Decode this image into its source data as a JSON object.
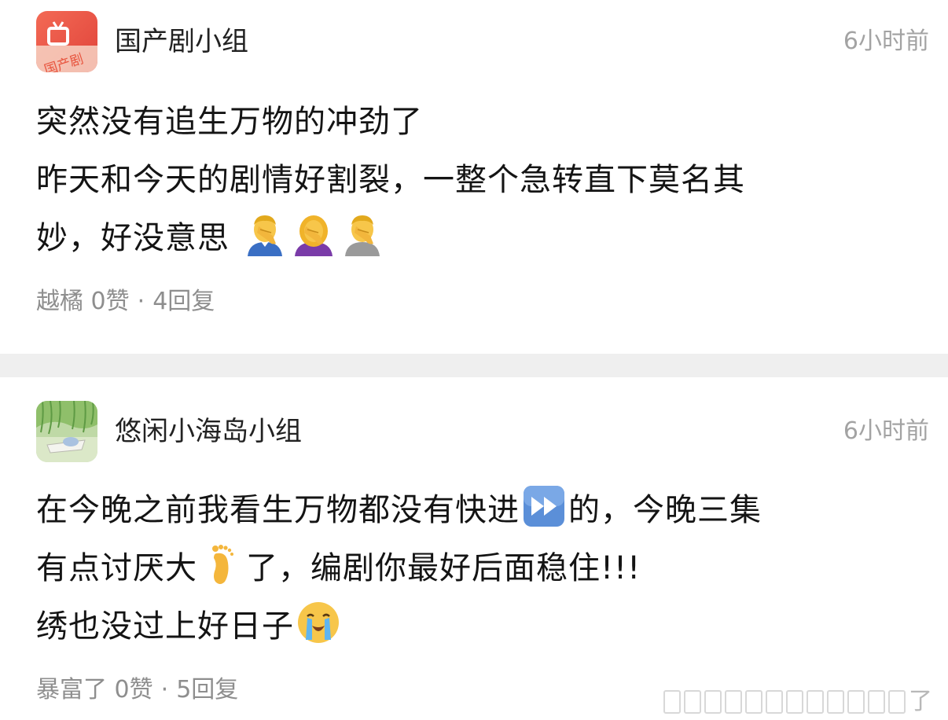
{
  "posts": [
    {
      "group_name": "国产剧小组",
      "avatar_text": "国产剧",
      "time": "6小时前",
      "lines": [
        [
          "突然没有追生万物的冲劲了"
        ],
        [
          "昨天和今天的剧情好割裂，一整个急转直下莫名其"
        ],
        [
          "妙，好没意思"
        ]
      ],
      "author": "越橘",
      "likes": "0赞",
      "separator": "·",
      "replies": "4回复",
      "icons": [
        "man-facepalming-emoji",
        "woman-facepalming-emoji",
        "person-facepalming-emoji"
      ]
    },
    {
      "group_name": "悠闲小海岛小组",
      "time": "6小时前",
      "line1_a": "在今晚之前我看生万物都没有快进",
      "line1_b": "的，今晚三集",
      "line2_a": "有点讨厌大",
      "line2_b": "了，编剧你最好后面稳住!!!",
      "line3": "绣也没过上好日子",
      "author": "暴富了",
      "likes": "0赞",
      "separator": "·",
      "replies": "5回复",
      "icons": [
        "fast-forward-emoji",
        "foot-emoji",
        "loudly-crying-face-emoji"
      ]
    }
  ],
  "watermark_tail": "了",
  "colors": {
    "avatar_red": "#e2453c",
    "meta_gray": "#8e8e8e",
    "time_gray": "#a3a3a3",
    "divider": "#efefef"
  }
}
